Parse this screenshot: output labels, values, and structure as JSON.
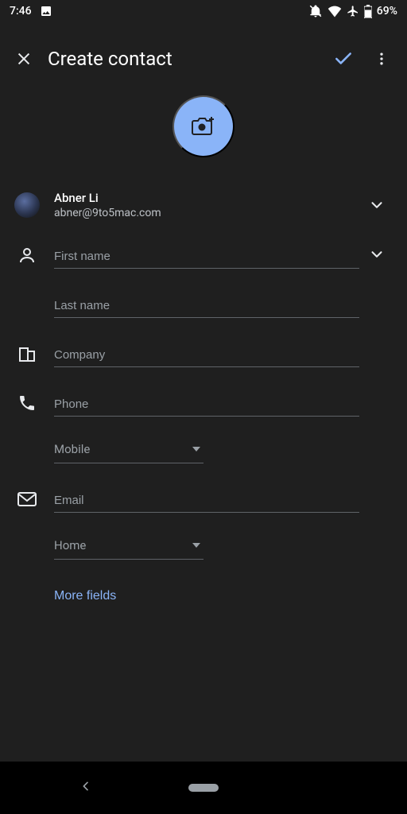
{
  "status": {
    "time": "7:46",
    "battery": "69%"
  },
  "appbar": {
    "title": "Create contact"
  },
  "account": {
    "name": "Abner Li",
    "email": "abner@9to5mac.com"
  },
  "fields": {
    "first_name_placeholder": "First name",
    "last_name_placeholder": "Last name",
    "company_placeholder": "Company",
    "phone_placeholder": "Phone",
    "phone_type": "Mobile",
    "email_placeholder": "Email",
    "email_type": "Home"
  },
  "more_fields_label": "More fields"
}
